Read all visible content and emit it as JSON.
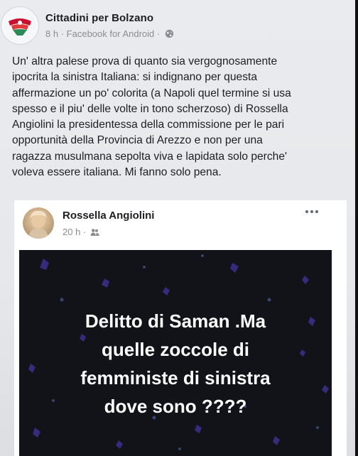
{
  "post": {
    "page_name": "Cittadini per Bolzano",
    "time": "8 h",
    "separator": "·",
    "source": "Facebook for Android",
    "separator2": "·",
    "privacy_icon": "globe-icon",
    "body": "Un' altra palese prova di quanto sia vergognosamente\nipocrita la sinistra Italiana: si indignano per questa\naffermazione un po' colorita (a Napoli quel termine si usa\nspesso e il piu' delle volte in tono scherzoso) di Rossella\nAngiolini la presidentessa della commissione per le pari\nopportunità della Provincia di Arezzo e non per una\nragazza musulmana sepolta viva e lapidata solo perche'\nvoleva essere italiana. Mi fanno solo pena."
  },
  "shared": {
    "author": "Rossella Angiolini",
    "time": "20 h",
    "separator": "·",
    "privacy_icon": "friends-icon",
    "more_icon": "more-dots-icon",
    "image_text": "Delitto di Saman .Ma\nquelle zoccole di\nfemministe di sinistra\ndove sono ????",
    "image_background": "#111319",
    "image_accent": "#3a2f8a"
  },
  "colors": {
    "text": "#1c1e21",
    "meta": "#8a8d91",
    "background": "#e9ebee"
  }
}
